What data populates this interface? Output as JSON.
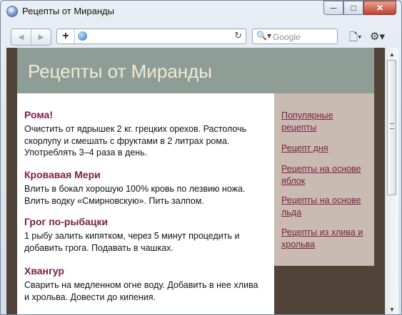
{
  "window": {
    "title": "Рецепты от Миранды",
    "minimize_icon": "─",
    "maximize_icon": "□",
    "close_icon": "✕"
  },
  "toolbar": {
    "back_icon": "◀",
    "forward_icon": "▶",
    "new_tab_icon": "+",
    "address_value": "",
    "reload_icon": "↻",
    "search_icon": "🔍▾",
    "search_placeholder": "Google",
    "page_menu_icon": "🗋▾",
    "tools_menu_icon": "⚙▾"
  },
  "page": {
    "title": "Рецепты от Миранды",
    "recipes": [
      {
        "name": "Рома!",
        "text": "Очистить от ядрышек 2 кг. грецких орехов. Растолочь скорлупу и смешать с фруктами в 2 литрах рома. Употреблять 3–4 раза в день."
      },
      {
        "name": "Кровавая Мери",
        "text": "Влить в бокал хорошую 100% кровь по лезвию ножа. Влить водку «Смирновскую». Пить залпом."
      },
      {
        "name": "Грог по-рыбацки",
        "text": "1 рыбу залить кипятком, через 5 минут процедить и добавить грога. Подавать в чашках."
      },
      {
        "name": "Хвангур",
        "text": "Сварить на медленном огне воду. Добавить в нее хлива и хрольва. Довести до кипения."
      }
    ],
    "sidebar_links": [
      "Популярные рецепты",
      "Рецепт дня",
      "Рецепты на основе яблок",
      "Рецепты на основе льда",
      "Рецепты из хлива и хрольва"
    ]
  },
  "scrollbar": {
    "up_icon": "▲",
    "down_icon": "▼"
  },
  "colors": {
    "page_background": "#524339",
    "header": "#8e9e96",
    "header_text": "#f1ead2",
    "sidebar": "#c9bbb1",
    "accent": "#7a2046"
  }
}
